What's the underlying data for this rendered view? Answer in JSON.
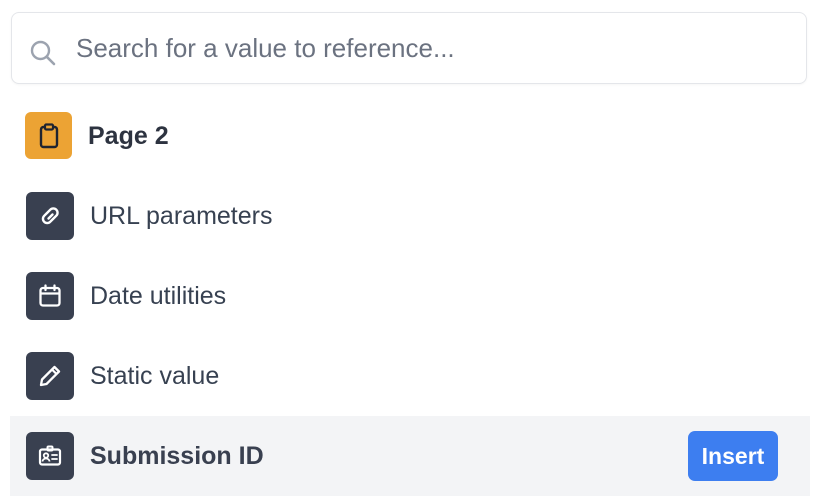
{
  "search": {
    "placeholder": "Search for a value to reference...",
    "value": ""
  },
  "items": [
    {
      "label": "Page 2",
      "icon": "clipboard-icon",
      "tile_color": "#eca334"
    },
    {
      "label": "URL parameters",
      "icon": "link-icon",
      "tile_color": "#394050"
    },
    {
      "label": "Date utilities",
      "icon": "calendar-icon",
      "tile_color": "#394050"
    },
    {
      "label": "Static value",
      "icon": "pencil-icon",
      "tile_color": "#394050"
    },
    {
      "label": "Submission ID",
      "icon": "id-card-icon",
      "tile_color": "#394050",
      "action_label": "Insert",
      "highlighted": true
    }
  ],
  "colors": {
    "accent": "#3d7ef0",
    "highlight_row": "#f3f4f6",
    "text": "#374151"
  }
}
